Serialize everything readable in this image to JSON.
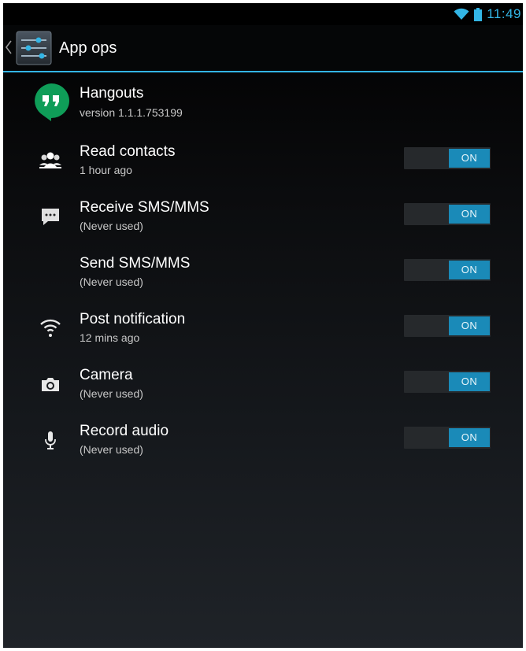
{
  "status_bar": {
    "time": "11:49",
    "icons": [
      "wifi-icon",
      "battery-icon"
    ]
  },
  "action_bar": {
    "title": "App ops",
    "icon": "settings-sliders-icon",
    "up_icon": "chevron-left-icon"
  },
  "app": {
    "name": "Hangouts",
    "version": "version 1.1.1.753199",
    "icon": "hangouts-icon"
  },
  "colors": {
    "accent": "#33b5e5",
    "toggle_on": "#1a8ab8",
    "hangouts_green": "#0f9d58"
  },
  "ops": [
    {
      "title": "Read contacts",
      "subtitle": "1 hour ago",
      "icon": "contacts-icon",
      "toggle": "ON"
    },
    {
      "title": "Receive SMS/MMS",
      "subtitle": "(Never used)",
      "icon": "message-icon",
      "toggle": "ON"
    },
    {
      "title": "Send SMS/MMS",
      "subtitle": "(Never used)",
      "icon": "",
      "toggle": "ON"
    },
    {
      "title": "Post notification",
      "subtitle": "12 mins ago",
      "icon": "wifi-notification-icon",
      "toggle": "ON"
    },
    {
      "title": "Camera",
      "subtitle": "(Never used)",
      "icon": "camera-icon",
      "toggle": "ON"
    },
    {
      "title": "Record audio",
      "subtitle": "(Never used)",
      "icon": "microphone-icon",
      "toggle": "ON"
    }
  ]
}
